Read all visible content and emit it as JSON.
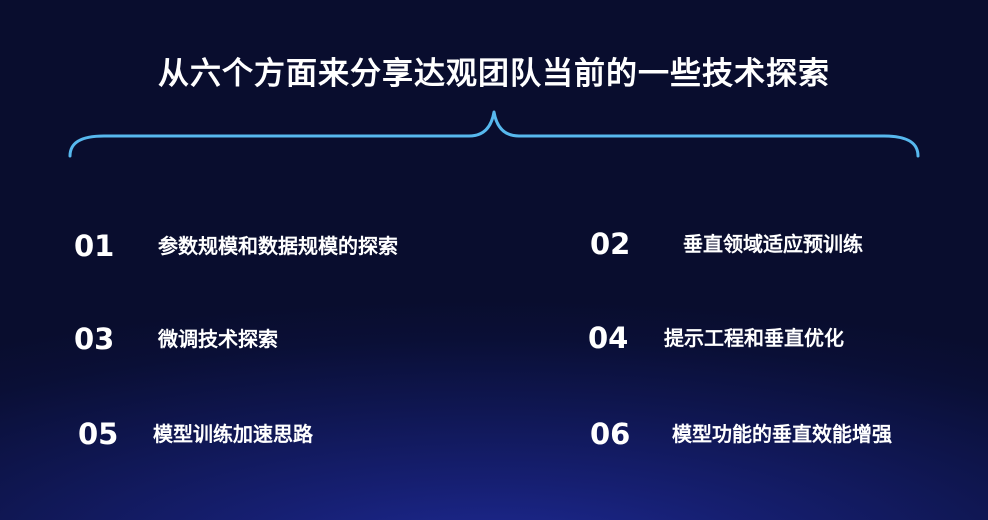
{
  "title": "从六个方面来分享达观团队当前的一些技术探索",
  "items": [
    {
      "num": "01",
      "label": "参数规模和数据规模的探索"
    },
    {
      "num": "02",
      "label": "垂直领域适应预训练"
    },
    {
      "num": "03",
      "label": "微调技术探索"
    },
    {
      "num": "04",
      "label": "提示工程和垂直优化"
    },
    {
      "num": "05",
      "label": "模型训练加速思路"
    },
    {
      "num": "06",
      "label": "模型功能的垂直效能增强"
    }
  ],
  "colors": {
    "background": "#0d1343",
    "text": "#ffffff",
    "brace": "#57b8ee"
  },
  "icons": [
    "curly-brace"
  ]
}
